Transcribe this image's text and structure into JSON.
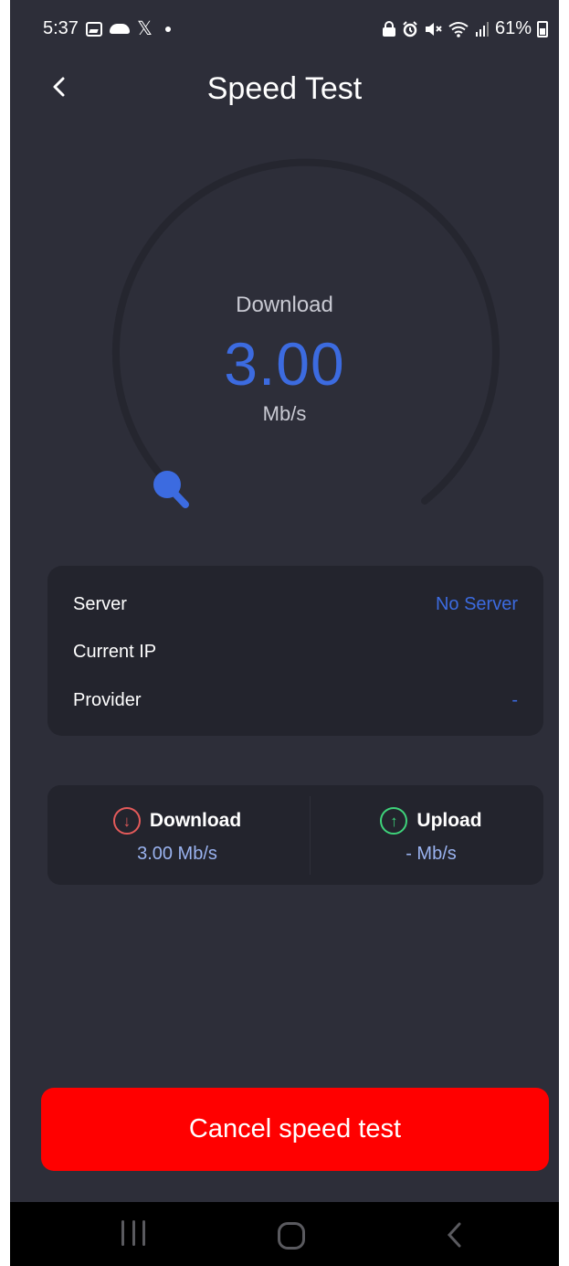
{
  "status_bar": {
    "time": "5:37",
    "left_icons": [
      "gallery-icon",
      "cloud-icon",
      "x-icon",
      "dot-icon"
    ],
    "right_icons": [
      "lock-icon",
      "alarm-icon",
      "mute-icon",
      "wifi-icon",
      "signal-icon"
    ],
    "battery": "61%"
  },
  "header": {
    "back_icon": "chevron-left-icon",
    "title": "Speed Test"
  },
  "gauge": {
    "label": "Download",
    "value": "3.00",
    "unit": "Mb/s",
    "accent": "#3c6be0",
    "track_color": "#25262f"
  },
  "info": {
    "rows": [
      {
        "label": "Server",
        "value": "No Server"
      },
      {
        "label": "Current IP",
        "value": ""
      },
      {
        "label": "Provider",
        "value": "-"
      }
    ]
  },
  "results": {
    "download": {
      "label": "Download",
      "value": "3.00 Mb/s",
      "icon": "arrow-down-circle-icon",
      "color": "#e35a5a"
    },
    "upload": {
      "label": "Upload",
      "value": "- Mb/s",
      "icon": "arrow-up-circle-icon",
      "color": "#3ed27a"
    }
  },
  "action": {
    "cancel_label": "Cancel speed test",
    "color": "#ff0000"
  },
  "nav": {
    "icons": [
      "recents-icon",
      "home-icon",
      "back-icon"
    ]
  }
}
